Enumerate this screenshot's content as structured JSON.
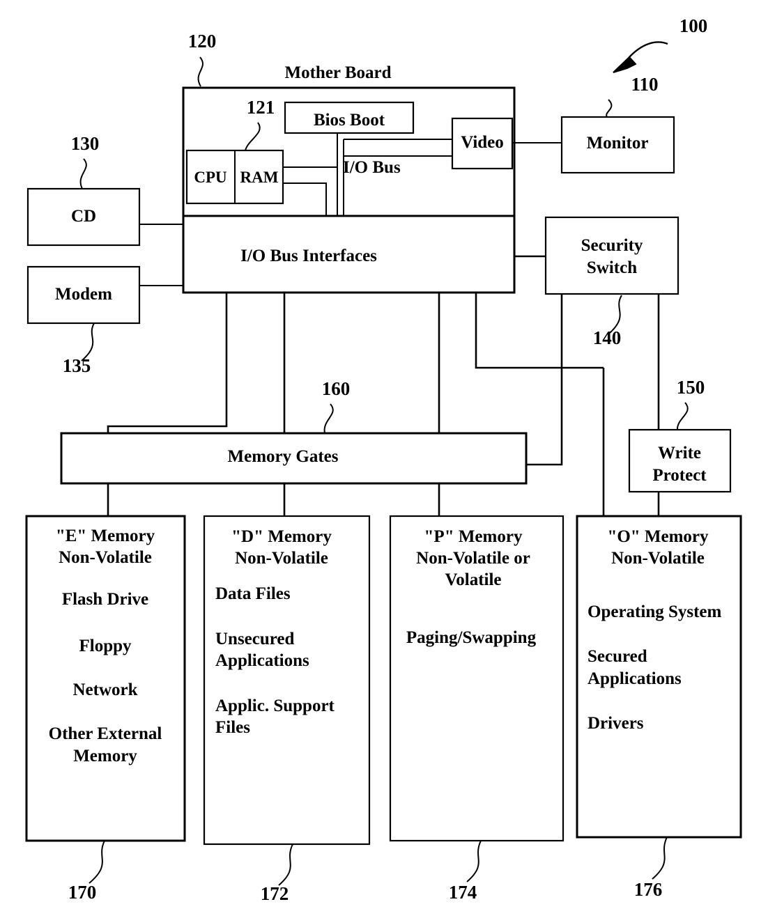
{
  "figure": {
    "title_ref": "100",
    "components": {
      "motherboard": {
        "label": "Mother Board",
        "ref": "120"
      },
      "cpu": {
        "label": "CPU"
      },
      "ram": {
        "label": "RAM",
        "ref": "121"
      },
      "bios_boot": {
        "label": "Bios  Boot"
      },
      "io_bus": {
        "label": "I/O Bus"
      },
      "video": {
        "label": "Video"
      },
      "monitor": {
        "label": "Monitor",
        "ref": "110"
      },
      "io_bus_interfaces": {
        "label": "I/O Bus Interfaces"
      },
      "cd": {
        "label": "CD",
        "ref": "130"
      },
      "modem": {
        "label": "Modem",
        "ref": "135"
      },
      "security_switch": {
        "label_line1": "Security",
        "label_line2": "Switch",
        "ref": "140"
      },
      "write_protect": {
        "label_line1": "Write",
        "label_line2": "Protect",
        "ref": "150"
      },
      "memory_gates": {
        "label": "Memory Gates",
        "ref": "160"
      }
    },
    "memory_blocks": [
      {
        "ref": "170",
        "header": [
          "\"E\" Memory",
          "Non-Volatile"
        ],
        "items": [
          "Flash Drive",
          "Floppy",
          "Network",
          "Other External\nMemory"
        ],
        "align": "center"
      },
      {
        "ref": "172",
        "header": [
          "\"D\"  Memory",
          "Non-Volatile"
        ],
        "items": [
          "Data Files",
          "Unsecured\nApplications",
          "Applic. Support\nFiles"
        ],
        "align": "left"
      },
      {
        "ref": "174",
        "header": [
          "\"P\"  Memory",
          "Non-Volatile or",
          "Volatile"
        ],
        "items": [
          "Paging/Swapping"
        ],
        "align": "center"
      },
      {
        "ref": "176",
        "header": [
          "\"O\"  Memory",
          "Non-Volatile"
        ],
        "items": [
          "Operating System",
          "Secured\nApplications",
          "Drivers"
        ],
        "align": "left"
      }
    ],
    "memory_block_text": {
      "e_header_1": "\"E\" Memory",
      "e_header_2": "Non-Volatile",
      "e_item_1": "Flash Drive",
      "e_item_2": "Floppy",
      "e_item_3": "Network",
      "e_item_4a": "Other External",
      "e_item_4b": "Memory",
      "d_header_1": "\"D\"  Memory",
      "d_header_2": "Non-Volatile",
      "d_item_1": "Data Files",
      "d_item_2a": "Unsecured",
      "d_item_2b": "Applications",
      "d_item_3a": "Applic. Support",
      "d_item_3b": "Files",
      "p_header_1": "\"P\"  Memory",
      "p_header_2": "Non-Volatile or",
      "p_header_3": "Volatile",
      "p_item_1": "Paging/Swapping",
      "o_header_1": "\"O\"  Memory",
      "o_header_2": "Non-Volatile",
      "o_item_1": "Operating System",
      "o_item_2a": "Secured",
      "o_item_2b": "Applications",
      "o_item_3": "Drivers"
    },
    "colors": {
      "ink": "#000000",
      "paper": "#ffffff"
    }
  }
}
